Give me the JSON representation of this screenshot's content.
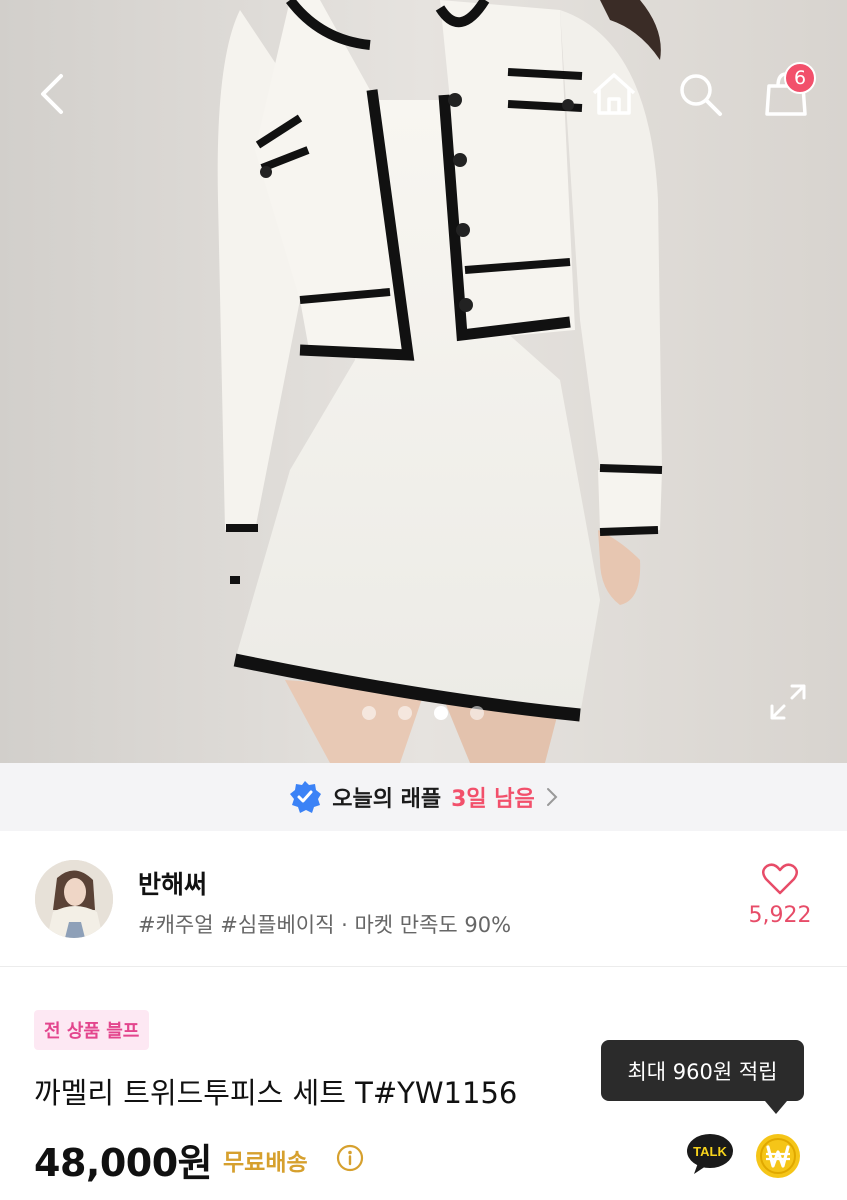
{
  "header": {
    "back_icon": "chevron-left-icon",
    "home_icon": "home-icon",
    "search_icon": "search-icon",
    "cart_icon": "shopping-bag-icon",
    "cart_count": "6"
  },
  "gallery": {
    "image_count": 4,
    "active_index": 2,
    "expand_icon": "expand-icon"
  },
  "raffle": {
    "icon": "verified-badge-icon",
    "label": "오늘의 래플",
    "remaining": "3일 남음"
  },
  "shop": {
    "name": "반해써",
    "tags": "#캐주얼 #심플베이직 · 마켓 만족도 90%",
    "like_count": "5,922",
    "like_icon": "heart-icon"
  },
  "product": {
    "badge": "전 상품 블프",
    "title": "까멜리 트위드투피스 세트 T#YW1156",
    "price": "48,000원",
    "shipping": "무료배송",
    "points_tooltip": "최대 960원 적립",
    "talk_label": "TALK",
    "coin_icon": "won-coin-icon"
  },
  "colors": {
    "accent_pink": "#f2506b",
    "badge_bg": "#fde8f3",
    "badge_text": "#e3458d",
    "shipping_gold": "#d6a02e",
    "verified_blue": "#3b82f6"
  }
}
